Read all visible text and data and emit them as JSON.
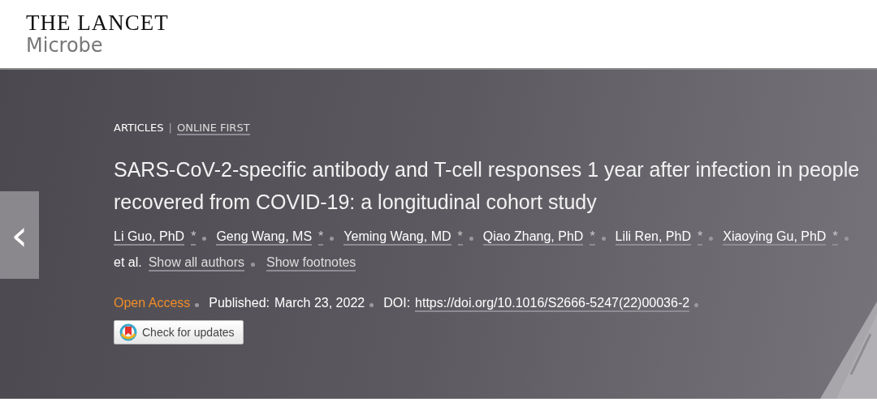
{
  "journal": {
    "name": "THE LANCET",
    "subtitle": "Microbe"
  },
  "article": {
    "type": "ARTICLES",
    "separator": "|",
    "status": "ONLINE FIRST",
    "title": "SARS-CoV-2-specific antibody and T-cell responses 1 year after infection in people recovered from COVID-19: a longitudinal cohort study",
    "authors": [
      {
        "name": "Li Guo, PhD",
        "mark": "*"
      },
      {
        "name": "Geng Wang, MS",
        "mark": "*"
      },
      {
        "name": "Yeming Wang, MD",
        "mark": "*"
      },
      {
        "name": "Qiao Zhang, PhD",
        "mark": "*"
      },
      {
        "name": "Lili Ren, PhD",
        "mark": "*"
      },
      {
        "name": "Xiaoying Gu, PhD",
        "mark": "*"
      }
    ],
    "et_al": "et al.",
    "show_authors": "Show all authors",
    "show_footnotes": "Show footnotes",
    "access": "Open Access",
    "published_label": "Published:",
    "published_date": "March 23, 2022",
    "doi_label": "DOI:",
    "doi": "https://doi.org/10.1016/S2666-5247(22)00036-2",
    "updates_button": "Check for updates"
  },
  "nav": {
    "previous": "‹"
  }
}
